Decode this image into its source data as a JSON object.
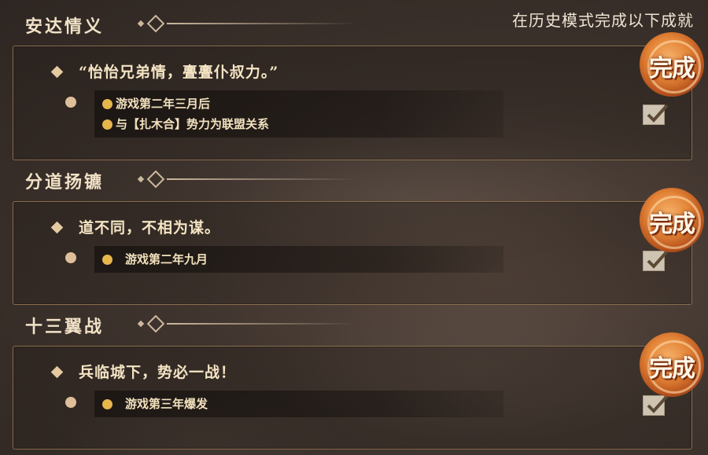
{
  "header": {
    "hint": "在历史模式完成以下成就"
  },
  "achievements": [
    {
      "title": "安达情义",
      "quote": "“怡怡兄弟情，亹亹仆叔力。”",
      "conditions": [
        "游戏第二年三月后",
        "与【扎木合】势力为联盟关系"
      ],
      "stamp": "完成"
    },
    {
      "title": "分道扬镳",
      "quote": "道不同，不相为谋。",
      "conditions": [
        "游戏第二年九月"
      ],
      "stamp": "完成"
    },
    {
      "title": "十三翼战",
      "quote": "兵临城下，势必一战！",
      "conditions": [
        "游戏第三年爆发"
      ],
      "stamp": "完成"
    }
  ],
  "colors": {
    "accent": "#e7b64c",
    "stamp": "#e38437",
    "border": "#8a6d4e"
  },
  "icons": {
    "check": "checkmark-icon",
    "diamond": "diamond-icon"
  }
}
